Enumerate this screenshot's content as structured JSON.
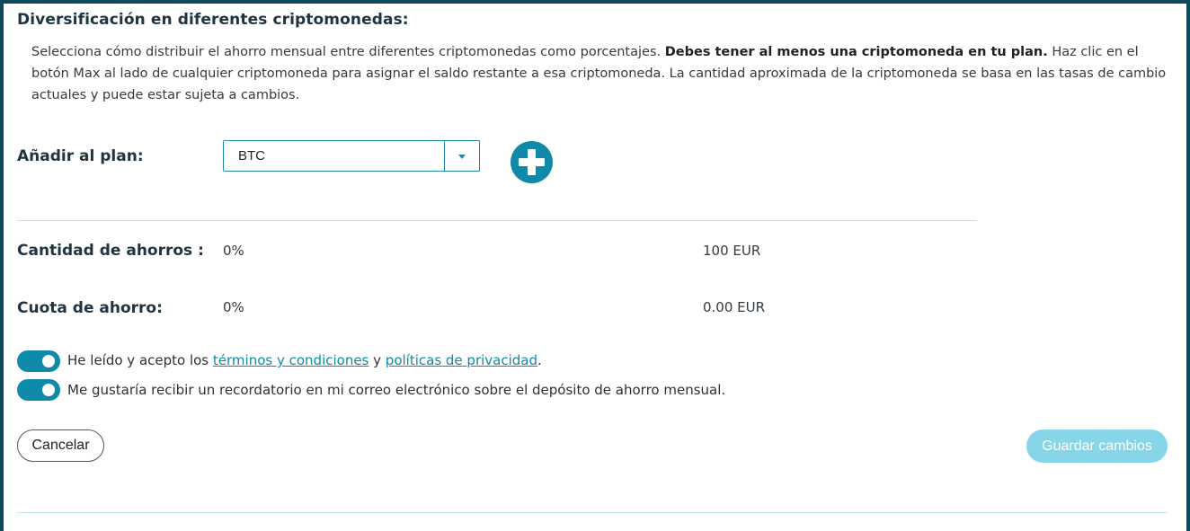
{
  "title": "Diversificación en diferentes criptomonedas:",
  "description": {
    "part1": "Selecciona cómo distribuir el ahorro mensual entre diferentes criptomonedas como porcentajes. ",
    "bold": "Debes tener al menos una criptomoneda en tu plan.",
    "part2": " Haz clic en el botón Max al lado de cualquier criptomoneda para asignar el saldo restante a esa criptomoneda. La cantidad aproximada de la criptomoneda se basa en las tasas de cambio actuales y puede estar sujeta a cambios."
  },
  "add_plan": {
    "label": "Añadir al plan:",
    "selected": "BTC",
    "add_icon": "plus-circle-icon"
  },
  "savings_amount": {
    "label": "Cantidad de ahorros :",
    "percent": "0%",
    "amount": "100 EUR"
  },
  "savings_fee": {
    "label": "Cuota de ahorro:",
    "percent": "0%",
    "amount": "0.00 EUR"
  },
  "toggles": {
    "terms": {
      "checked": true,
      "prefix": "He leído y acepto los ",
      "terms_link": "términos y condiciones",
      "middle": " y ",
      "privacy_link": "políticas de privacidad",
      "suffix": "."
    },
    "reminder": {
      "checked": true,
      "text": "Me gustaría recibir un recordatorio en mi correo electrónico sobre el depósito de ahorro mensual."
    }
  },
  "buttons": {
    "cancel": "Cancelar",
    "save": "Guardar cambios"
  },
  "colors": {
    "accent": "#0f8aa8",
    "save_disabled": "#86d5e9",
    "frame": "#0e4a5c"
  }
}
